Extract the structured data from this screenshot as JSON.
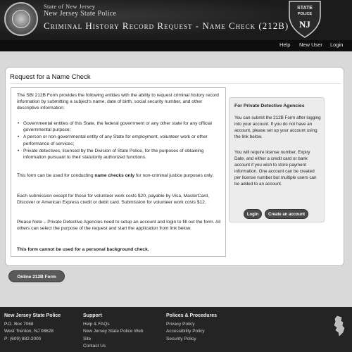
{
  "header": {
    "state_line": "State of New Jersey",
    "agency_line": "New Jersey State Police",
    "title": "Criminal History Record Request - Name Check (212B)",
    "badge_text_top": "STATE",
    "badge_text_mid": "POLICE",
    "badge_letters": "NJ",
    "icons": [
      "state-seal-icon",
      "state-police-badge-icon"
    ]
  },
  "nav": {
    "items": [
      {
        "label": "Help"
      },
      {
        "label": "New User"
      },
      {
        "label": "Login"
      }
    ]
  },
  "main": {
    "title": "Request for a Name Check",
    "intro": "The SBI 212B Form provides the following entities with the ability to request criminal history record information by submitting a subject's name, date of birth, social security number, and other descriptive information:",
    "bullets": [
      "Governmental entities of this State, the federal government or any other state for any official governmental purpose;",
      "A person or non-governmental entity of any State for employment, volunteer work or other performance of services;",
      "Private detectives, licensed by the Division of State Police, for the purposes of obtaining information pursuant to their statutorily authorized functions."
    ],
    "usage_pre": "This form can be used for conducting ",
    "usage_bold": "name checks only",
    "usage_post": " for non-criminal justice purposes only.",
    "cost": "Each submission except for those for volunteer work costs $20, payable by Visa, MasterCard, Discover or American Express credit or debit card. Submission for volunteer work costs $12.",
    "note": "Please Note – Private Detective Agencies need to setup an account and login to fill out the form. All others can select the purpose of the request and start the application from link below.",
    "warning": "This form cannot be used for a personal background check.",
    "online_button": "Online 212B Form"
  },
  "pda": {
    "heading": "For Private Detective Agencies",
    "p1": "You can submit the 212B Form after logging into your account. If you do not have an account, please set up your account using the link below.",
    "p2": "You will require license number, Expiry Date, and either a credit card or bank account if you wish to store payment information. One account can be created per license number but multiple users can be added to an account.",
    "login_button": "Login",
    "create_button": "Create an account"
  },
  "footer": {
    "col1": {
      "heading": "New Jersey State Police",
      "lines": [
        "P.O. Box 7068",
        "West Trenton, NJ 08628",
        "P: (609) 882-2000"
      ]
    },
    "col2": {
      "heading": "Support",
      "links": [
        "Help & FAQs",
        "New Jersey State Police Web",
        "Site",
        "Contact Us"
      ]
    },
    "col3": {
      "heading": "Polices & Procedures",
      "links": [
        "Privacy Policy",
        "Accessibility Policy",
        "Security Policy"
      ]
    },
    "icon": "new-jersey-state-outline-icon"
  }
}
